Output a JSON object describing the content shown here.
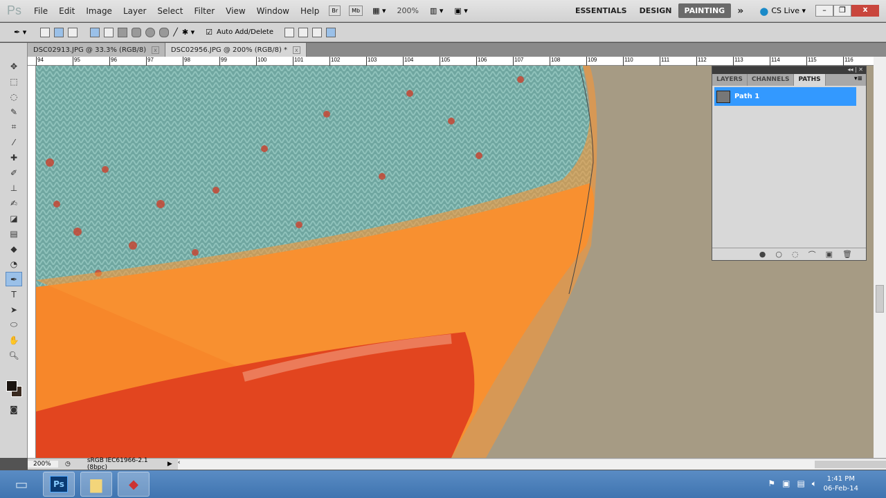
{
  "app": {
    "logo": "Ps"
  },
  "menu": [
    "File",
    "Edit",
    "Image",
    "Layer",
    "Select",
    "Filter",
    "View",
    "Window",
    "Help"
  ],
  "appbar": {
    "bridge": "Br",
    "mini_bridge": "Mb",
    "zoom": "200%",
    "workspaces": [
      "ESSENTIALS",
      "DESIGN",
      "PAINTING"
    ],
    "active_workspace": "PAINTING",
    "more": "»",
    "cs_live": "CS Live ▾"
  },
  "options": {
    "auto_add_delete_label": "Auto Add/Delete",
    "auto_add_delete_checked": true
  },
  "tabs": [
    {
      "label": "DSC02913.JPG @ 33.3% (RGB/8)",
      "active": false
    },
    {
      "label": "DSC02956.JPG @ 200% (RGB/8) *",
      "active": true
    }
  ],
  "ruler": [
    "94",
    "95",
    "96",
    "97",
    "98",
    "99",
    "100",
    "101",
    "102",
    "103",
    "104",
    "105",
    "106",
    "107",
    "108",
    "109",
    "110",
    "111",
    "112",
    "113",
    "114",
    "115",
    "116"
  ],
  "panel": {
    "tabs": [
      "LAYERS",
      "CHANNELS",
      "PATHS"
    ],
    "active_tab": "PATHS",
    "paths": [
      {
        "name": "Path 1",
        "selected": true
      }
    ]
  },
  "status": {
    "zoom": "200%",
    "profile": "sRGB IEC61966-2.1 (8bpc)"
  },
  "clock": {
    "time": "1:41 PM",
    "date": "06-Feb-14"
  }
}
